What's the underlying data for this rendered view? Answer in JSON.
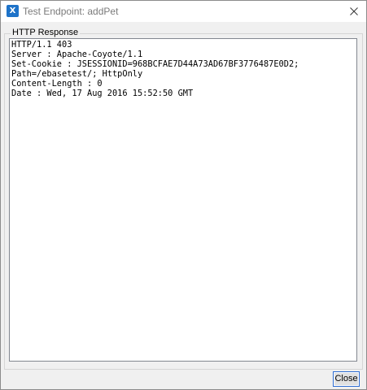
{
  "window": {
    "app_icon_text": "X",
    "title": "Test Endpoint: addPet"
  },
  "group": {
    "label": "HTTP Response"
  },
  "response": {
    "text": "HTTP/1.1 403\nServer : Apache-Coyote/1.1\nSet-Cookie : JSESSIONID=968BCFAE7D44A73AD67BF3776487E0D2;\nPath=/ebasetest/; HttpOnly\nContent-Length : 0\nDate : Wed, 17 Aug 2016 15:52:50 GMT"
  },
  "buttons": {
    "close_label": "Close"
  },
  "colors": {
    "accent_border": "#2c6bd1",
    "app_icon": "#1e73c9"
  }
}
